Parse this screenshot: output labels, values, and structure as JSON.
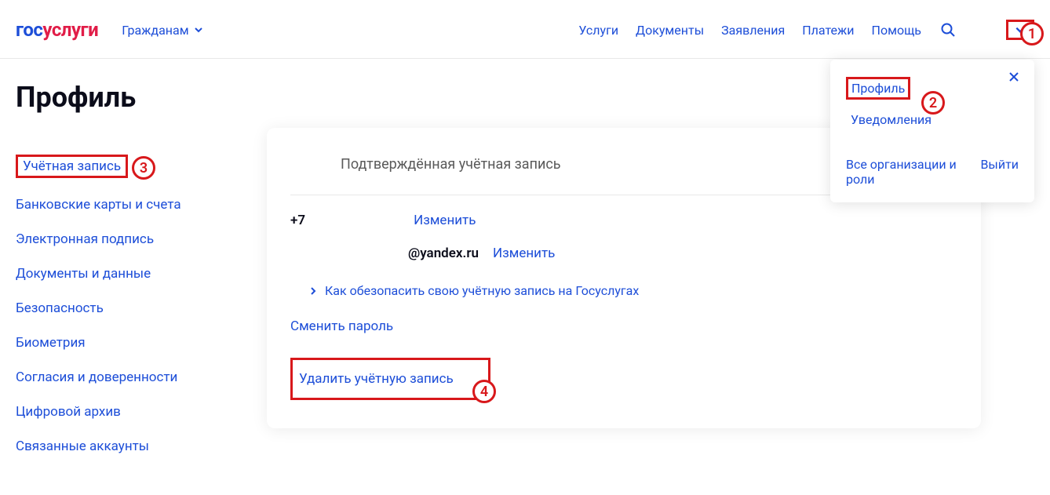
{
  "header": {
    "logo_gos": "гос",
    "logo_usl": "услуги",
    "audience": "Гражданам",
    "nav": [
      "Услуги",
      "Документы",
      "Заявления",
      "Платежи",
      "Помощь"
    ]
  },
  "annotations": {
    "a1": "1",
    "a2": "2",
    "a3": "3",
    "a4": "4"
  },
  "popover": {
    "profile": "Профиль",
    "notifications": "Уведомления",
    "orgs": "Все организации и роли",
    "logout": "Выйти"
  },
  "page": {
    "title": "Профиль",
    "sidebar": [
      "Учётная запись",
      "Банковские карты и счета",
      "Электронная подпись",
      "Документы и данные",
      "Безопасность",
      "Биометрия",
      "Согласия и доверенности",
      "Цифровой архив",
      "Связанные аккаунты"
    ]
  },
  "card": {
    "status": "Подтверждённая учётная запись",
    "phone": "+7",
    "change": "Изменить",
    "email": "@yandex.ru",
    "secure_help": "Как обезопасить свою учётную запись на Госуслугах",
    "change_password": "Сменить пароль",
    "delete_account": "Удалить учётную запись"
  }
}
